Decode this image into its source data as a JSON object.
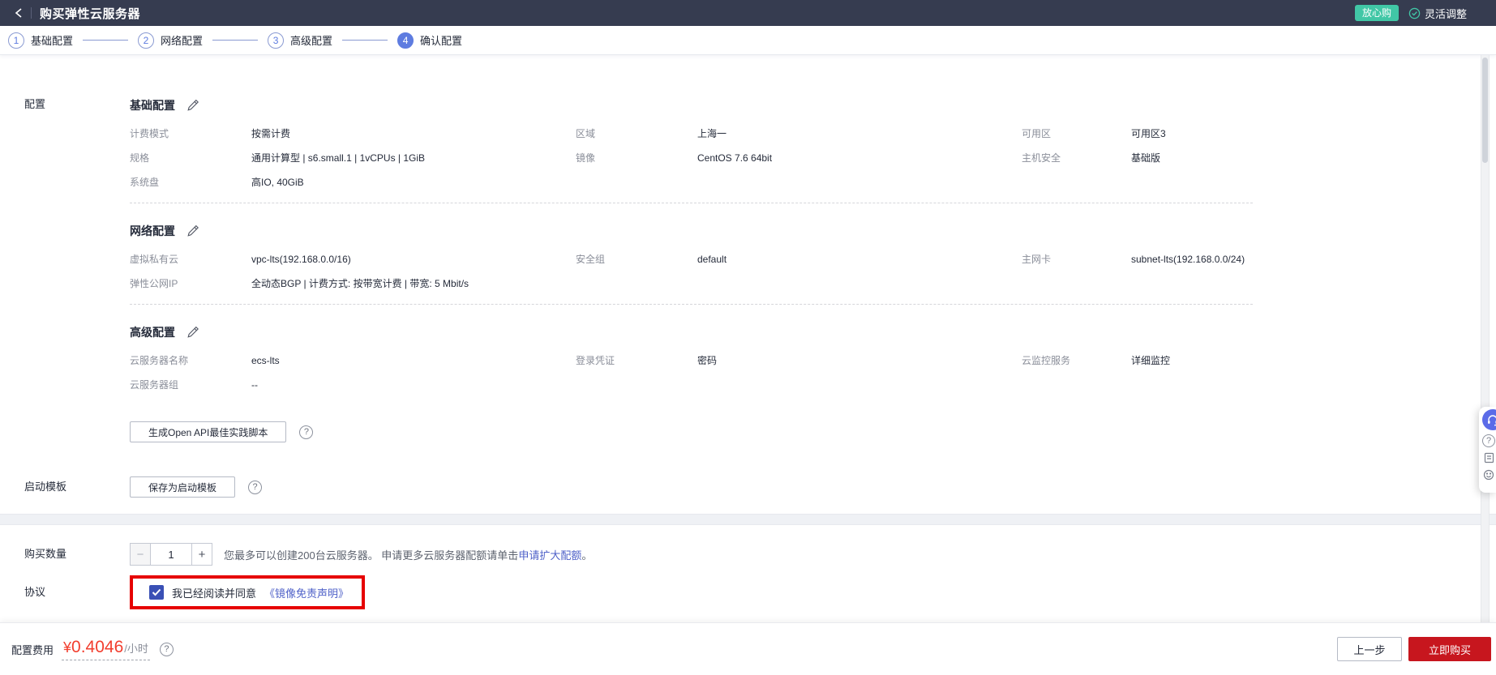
{
  "header": {
    "title": "购买弹性云服务器",
    "badge": "放心购",
    "adjust_label": "灵活调整"
  },
  "steps": [
    {
      "num": "1",
      "label": "基础配置"
    },
    {
      "num": "2",
      "label": "网络配置"
    },
    {
      "num": "3",
      "label": "高级配置"
    },
    {
      "num": "4",
      "label": "确认配置"
    }
  ],
  "config": {
    "side_label": "配置",
    "sections": [
      {
        "title": "基础配置",
        "rows": [
          [
            {
              "label": "计费模式",
              "value": "按需计费"
            },
            {
              "label": "区域",
              "value": "上海一"
            },
            {
              "label": "可用区",
              "value": "可用区3"
            }
          ],
          [
            {
              "label": "规格",
              "value": "通用计算型 | s6.small.1 | 1vCPUs | 1GiB"
            },
            {
              "label": "镜像",
              "value": "CentOS 7.6 64bit"
            },
            {
              "label": "主机安全",
              "value": "基础版"
            }
          ],
          [
            {
              "label": "系统盘",
              "value": "高IO, 40GiB"
            }
          ]
        ]
      },
      {
        "title": "网络配置",
        "rows": [
          [
            {
              "label": "虚拟私有云",
              "value": "vpc-lts(192.168.0.0/16)"
            },
            {
              "label": "安全组",
              "value": "default"
            },
            {
              "label": "主网卡",
              "value": "subnet-lts(192.168.0.0/24)"
            }
          ],
          [
            {
              "label": "弹性公网IP",
              "value": "全动态BGP | 计费方式: 按带宽计费 | 带宽: 5 Mbit/s"
            }
          ]
        ]
      },
      {
        "title": "高级配置",
        "rows": [
          [
            {
              "label": "云服务器名称",
              "value": "ecs-lts"
            },
            {
              "label": "登录凭证",
              "value": "密码"
            },
            {
              "label": "云监控服务",
              "value": "详细监控"
            }
          ],
          [
            {
              "label": "云服务器组",
              "value": "--"
            }
          ]
        ]
      }
    ],
    "api_script_button": "生成Open API最佳实践脚本",
    "launch_template_label": "启动模板",
    "save_template_button": "保存为启动模板"
  },
  "purchase": {
    "quantity_label": "购买数量",
    "quantity_value": "1",
    "minus_icon": "−",
    "plus_icon": "+",
    "hint_text": "您最多可以创建200台云服务器。 申请更多云服务器配额请单击",
    "hint_link": "申请扩大配额",
    "hint_suffix": "。",
    "agreement_label": "协议",
    "agreement_text": "我已经阅读并同意",
    "agreement_link": "《镜像免责声明》"
  },
  "footer": {
    "fee_label": "配置费用",
    "currency": "¥",
    "price": "0.4046",
    "unit": "/小时",
    "prev_button": "上一步",
    "buy_button": "立即购买"
  },
  "icons": {
    "help": "?"
  },
  "colors": {
    "header_bg": "#363c50",
    "accent_blue": "#5e7ce0",
    "link_blue": "#4f61c8",
    "badge_green": "#41c7a6",
    "buy_red": "#c7161e",
    "price_red": "#f23e2e",
    "highlight_red": "#e60000",
    "checkbox_blue": "#3a50b5"
  }
}
